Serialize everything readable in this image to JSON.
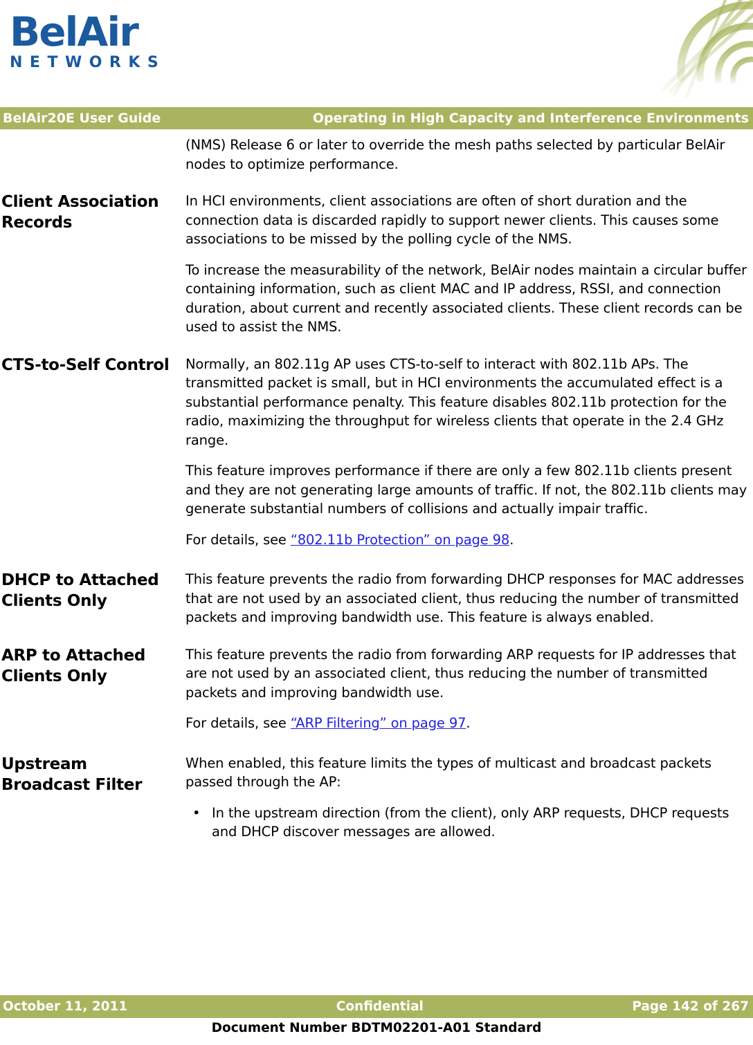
{
  "logo": {
    "wordmark": "BelAir",
    "subtext": "NETWORKS",
    "brand_color": "#1a5a9e",
    "corner_graphic_icon": "radial-web-arc-graphic"
  },
  "header": {
    "left_title": "BelAir20E User Guide",
    "right_title": "Operating in High Capacity and Interference Environments",
    "band_color": "#a9b45f",
    "text_color": "#ffffff"
  },
  "intro": {
    "paragraph": "(NMS) Release 6 or later to override the mesh paths selected by particular BelAir nodes to optimize performance."
  },
  "sections": [
    {
      "heading": "Client Association Records",
      "paragraphs": [
        "In HCI environments, client associations are often of short duration and the connection data is discarded rapidly to support newer clients. This causes some associations to be missed by the polling cycle of the NMS.",
        "To increase the measurability of the network, BelAir nodes maintain a circular buffer containing information, such as client MAC and IP address, RSSI, and connection duration, about current and recently associated clients. These client records can be used to assist the NMS."
      ]
    },
    {
      "heading": "CTS-to-Self Control",
      "paragraphs": [
        "Normally, an 802.11g AP uses CTS-to-self to interact with 802.11b APs. The transmitted packet is small, but in HCI environments the accumulated effect is a substantial performance penalty. This feature disables 802.11b protection for the radio, maximizing the throughput for wireless clients that operate in the 2.4 GHz range.",
        "This feature improves performance if there are only a few 802.11b clients present and they are not generating large amounts of traffic. If not, the 802.11b clients may generate substantial numbers of collisions and actually impair traffic."
      ],
      "xref_line": {
        "prefix": "For details, see ",
        "link_text": "“802.11b Protection” on page 98",
        "suffix": ".",
        "link_color": "#2222dd"
      }
    },
    {
      "heading": "DHCP to Attached Clients Only",
      "paragraphs": [
        "This feature prevents the radio from forwarding DHCP responses for MAC addresses that are not used by an associated client, thus reducing the number of transmitted packets and improving bandwidth use. This feature is always enabled."
      ]
    },
    {
      "heading": "ARP to Attached Clients Only",
      "paragraphs": [
        "This feature prevents the radio from forwarding ARP requests for IP addresses that are not used by an associated client, thus reducing the number of transmitted packets and improving bandwidth use."
      ],
      "xref_line": {
        "prefix": "For details, see ",
        "link_text": "“ARP Filtering” on page 97",
        "suffix": ".",
        "link_color": "#2222dd"
      }
    },
    {
      "heading": "Upstream Broadcast Filter",
      "paragraphs": [
        "When enabled, this feature limits the types of multicast and broadcast packets passed through the AP:"
      ],
      "bullets": [
        "In the upstream direction (from the client), only ARP requests, DHCP requests and DHCP discover messages are allowed."
      ],
      "bullet_marker": "•"
    }
  ],
  "footer": {
    "date": "October 11, 2011",
    "classification": "Confidential",
    "page_label": "Page 142 of 267",
    "document_number": "Document Number BDTM02201-A01 Standard",
    "band_color": "#a9b45f"
  }
}
